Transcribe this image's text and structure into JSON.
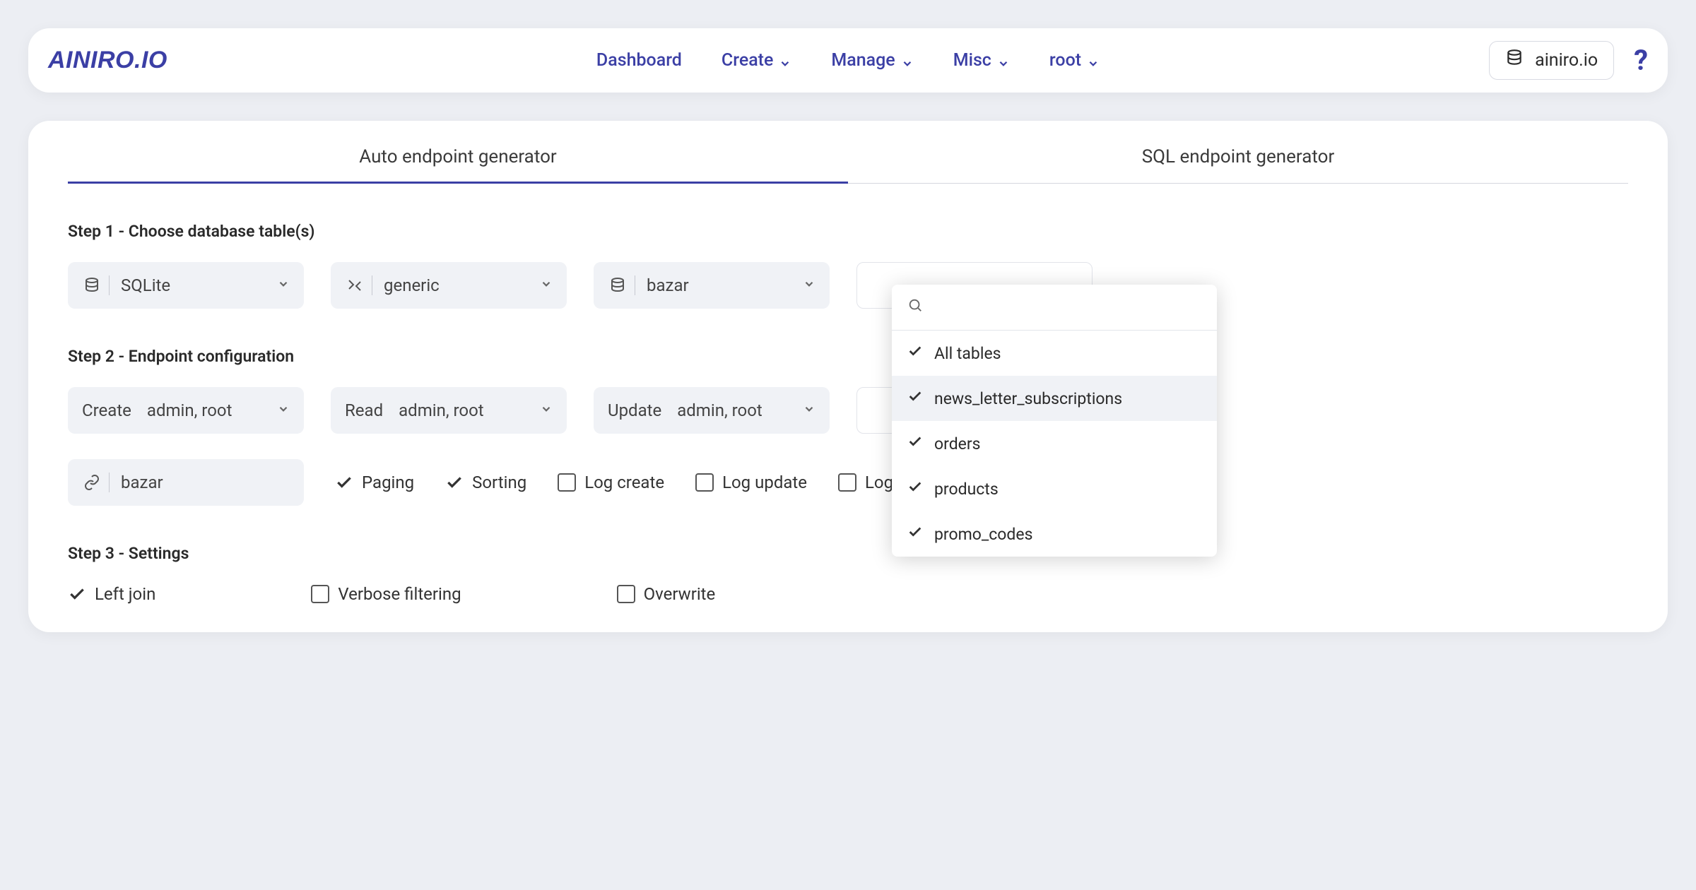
{
  "header": {
    "logo": "AINIRO.IO",
    "nav": {
      "dashboard": "Dashboard",
      "create": "Create",
      "manage": "Manage",
      "misc": "Misc",
      "root": "root"
    },
    "tenant": "ainiro.io",
    "help": "?"
  },
  "tabs": {
    "auto": "Auto endpoint generator",
    "sql": "SQL endpoint generator"
  },
  "steps": {
    "one": "Step 1 - Choose database table(s)",
    "two": "Step 2 - Endpoint configuration",
    "three": "Step 3 - Settings"
  },
  "step1": {
    "db_engine": "SQLite",
    "connection": "generic",
    "database": "bazar"
  },
  "step2": {
    "roles_value": "admin, root",
    "create_label": "Create",
    "read_label": "Read",
    "update_label": "Update",
    "url_prefix": "bazar",
    "opts": {
      "paging": "Paging",
      "sorting": "Sorting",
      "log_create": "Log create",
      "log_update": "Log update",
      "log_delete": "Log delete"
    }
  },
  "step3": {
    "left_join": "Left join",
    "verbose": "Verbose filtering",
    "overwrite": "Overwrite"
  },
  "dropdown": {
    "search_placeholder": "",
    "items": {
      "all": "All tables",
      "nls": "news_letter_subscriptions",
      "orders": "orders",
      "products": "products",
      "promo": "promo_codes"
    }
  }
}
